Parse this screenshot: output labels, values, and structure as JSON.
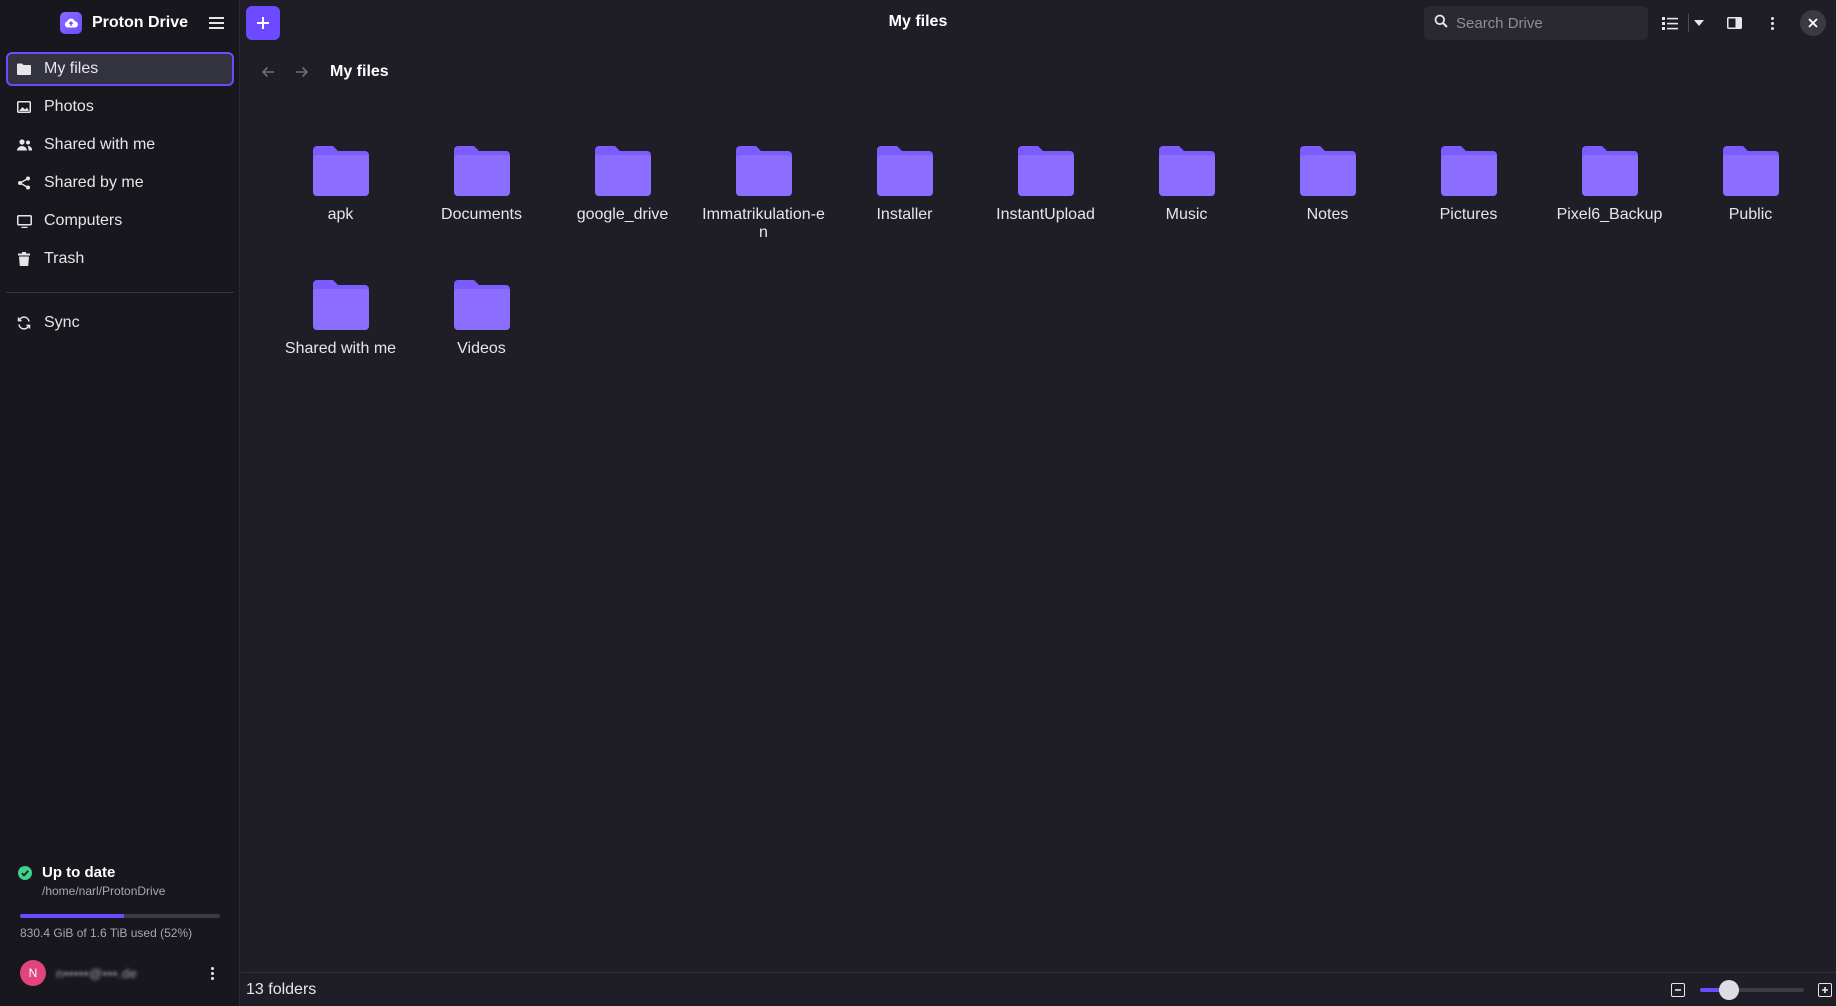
{
  "app": {
    "name": "Proton Drive",
    "page_title": "My files"
  },
  "sidebar": {
    "items": [
      {
        "label": "My files",
        "icon": "folder-icon",
        "active": true
      },
      {
        "label": "Photos",
        "icon": "image-icon"
      },
      {
        "label": "Shared with me",
        "icon": "users-icon"
      },
      {
        "label": "Shared by me",
        "icon": "share-icon"
      },
      {
        "label": "Computers",
        "icon": "monitor-icon"
      },
      {
        "label": "Trash",
        "icon": "trash-icon"
      }
    ],
    "sync": {
      "label": "Sync",
      "icon": "sync-icon"
    }
  },
  "status": {
    "title": "Up to date",
    "path": "/home/narl/ProtonDrive",
    "quota_text": "830.4 GiB of 1.6 TiB used (52%)",
    "quota_fraction": 0.52
  },
  "user": {
    "initial": "N",
    "name": "n•••••@•••.de"
  },
  "search": {
    "placeholder": "Search Drive",
    "value": ""
  },
  "breadcrumb": {
    "current": "My files"
  },
  "folders": [
    "apk",
    "Documents",
    "google_drive",
    "Immatrikulation-en",
    "Installer",
    "InstantUpload",
    "Music",
    "Notes",
    "Pictures",
    "Pixel6_Backup",
    "Public",
    "Shared with me",
    "Videos"
  ],
  "footer": {
    "count_text": "13 folders",
    "zoom_fraction": 0.2
  },
  "colors": {
    "accent": "#6d4aff",
    "folder": "#7c5cff",
    "background": "#1f1e26",
    "sidebar": "#18171d"
  }
}
